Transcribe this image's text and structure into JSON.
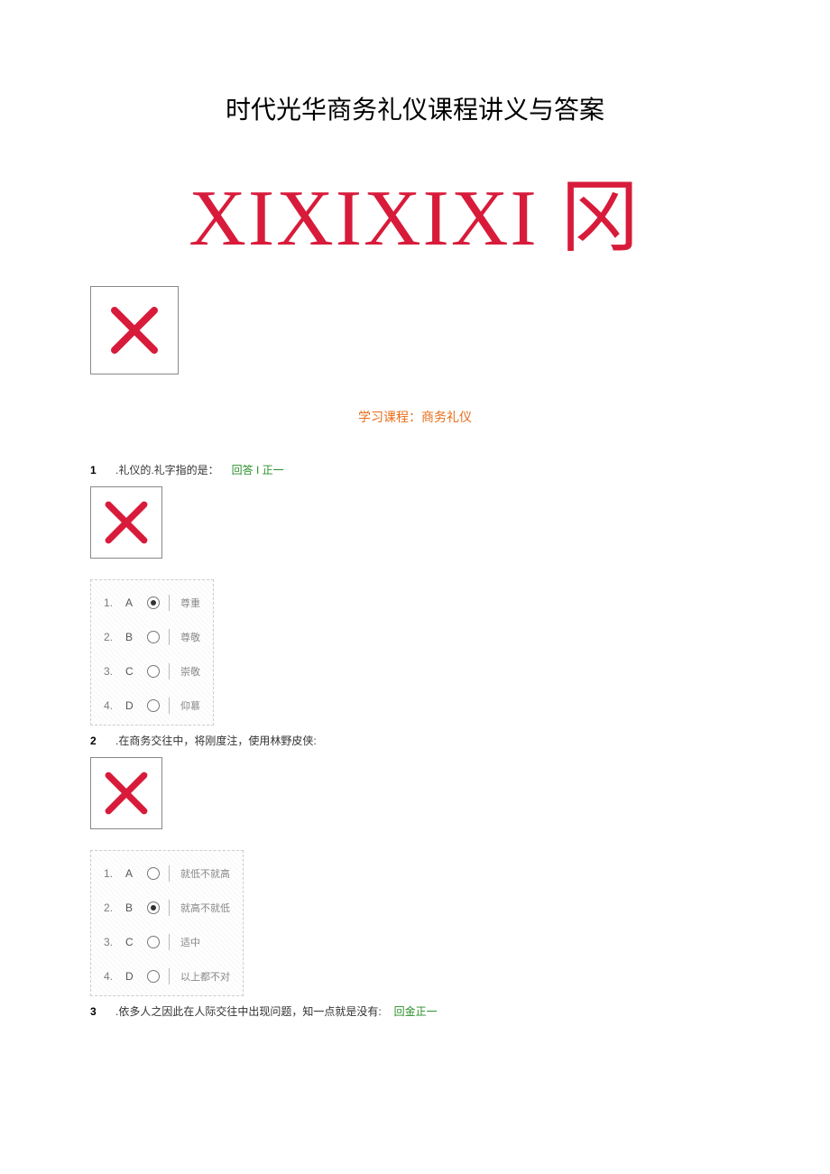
{
  "doc_title": "时代光华商务礼仪课程讲义与答案",
  "big_red_text": "XIXIXIXI 冈",
  "course_line": "学习课程：商务礼仪",
  "questions": [
    {
      "num": "1",
      "text": ".礼仪的.礼字指的是：",
      "feedback": "回答 I 正一",
      "options": [
        {
          "idx": "1.",
          "letter": "A",
          "selected": true,
          "label": "尊重"
        },
        {
          "idx": "2.",
          "letter": "B",
          "selected": false,
          "label": "尊敬"
        },
        {
          "idx": "3.",
          "letter": "C",
          "selected": false,
          "label": "崇敬"
        },
        {
          "idx": "4.",
          "letter": "D",
          "selected": false,
          "label": "仰慕"
        }
      ]
    },
    {
      "num": "2",
      "text": ".在商务交往中，将刚度注，使用林野皮侠:",
      "feedback": "",
      "options": [
        {
          "idx": "1.",
          "letter": "A",
          "selected": false,
          "label": "就低不就高"
        },
        {
          "idx": "2.",
          "letter": "B",
          "selected": true,
          "label": "就高不就低"
        },
        {
          "idx": "3.",
          "letter": "C",
          "selected": false,
          "label": "适中"
        },
        {
          "idx": "4.",
          "letter": "D",
          "selected": false,
          "label": "以上都不对"
        }
      ]
    },
    {
      "num": "3",
      "text": ".依多人之因此在人际交往中出现问题，知一点就是没有:",
      "feedback": "回金正一",
      "options": []
    }
  ]
}
